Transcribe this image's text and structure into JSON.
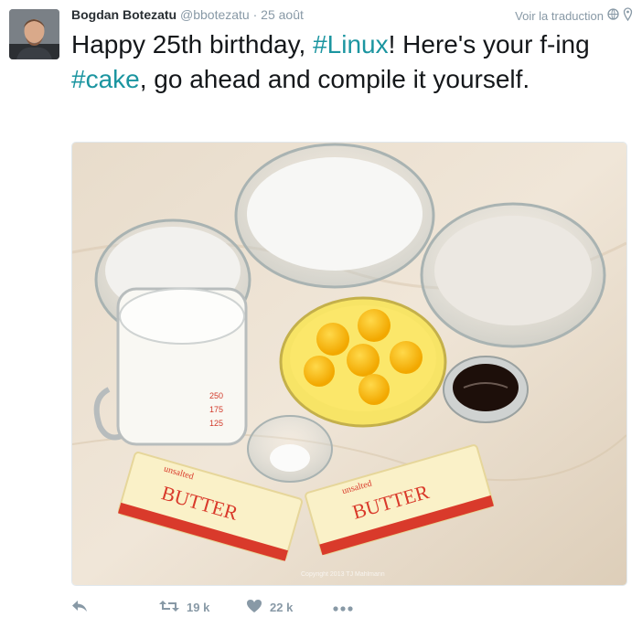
{
  "tweet": {
    "author_name": "Bogdan Botezatu",
    "handle": "@bbotezatu",
    "separator": "·",
    "date": "25 août",
    "translate_label": "Voir la traduction",
    "text_parts": [
      {
        "text": "Happy 25th birthday, ",
        "kind": "plain"
      },
      {
        "text": "#Linux",
        "kind": "hashtag"
      },
      {
        "text": "! Here's your f-ing ",
        "kind": "plain"
      },
      {
        "text": "#cake",
        "kind": "hashtag"
      },
      {
        "text": ", go ahead and compile it yourself.",
        "kind": "plain"
      }
    ],
    "media": {
      "butter_label": "BUTTER",
      "unsalted_label": "unsalted",
      "copyright": "Copyright 2013 TJ Mahlmann"
    },
    "actions": {
      "reply_icon": "reply-icon",
      "retweet_icon": "retweet-icon",
      "retweet_count": "19 k",
      "like_icon": "heart-icon",
      "like_count": "22 k",
      "more_icon": "more-icon"
    },
    "colors": {
      "hashtag": "#1b95a0",
      "muted": "#8899a6",
      "text": "#14171a"
    }
  }
}
